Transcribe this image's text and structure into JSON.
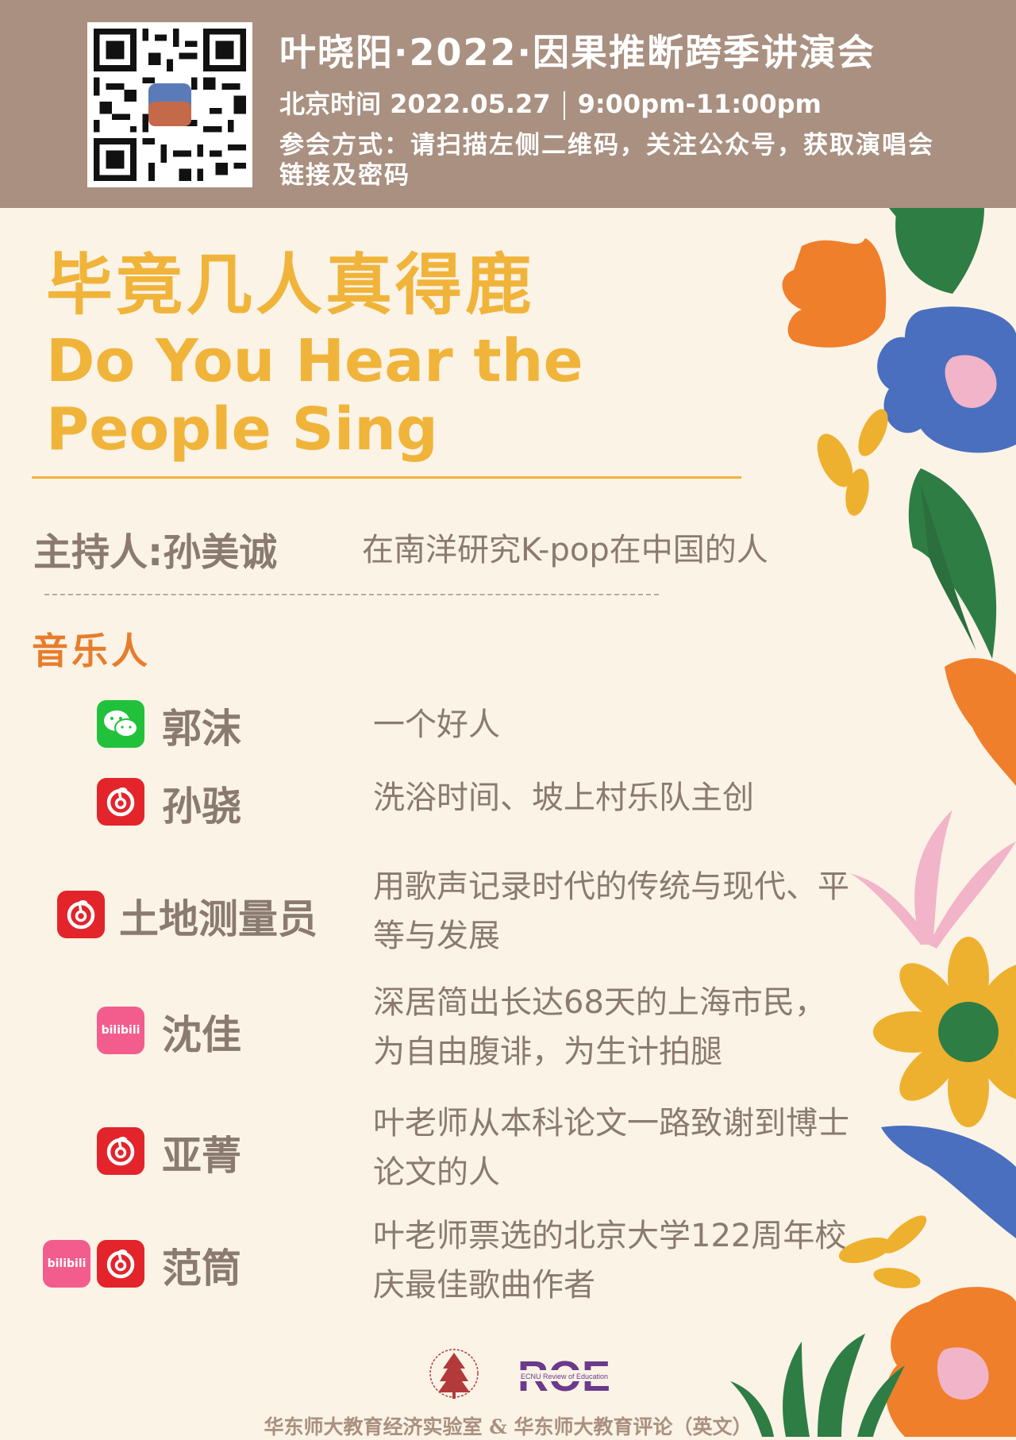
{
  "header": {
    "title": "叶晓阳·2022·因果推断跨季讲演会",
    "date": "北京时间 2022.05.27",
    "time": "9:00pm-11:00pm",
    "join_info": "参会方式：请扫描左侧二维码，关注公众号，获取演唱会链接及密码"
  },
  "event": {
    "title_zh": "毕竟几人真得鹿",
    "title_en_line1": "Do You Hear the",
    "title_en_line2": "People Sing"
  },
  "host": {
    "label": "主持人:孙美诚",
    "description": "在南洋研究K-pop在中国的人"
  },
  "musicians_heading": "音乐人",
  "musicians": [
    {
      "name": "郭沫",
      "icons": [
        "wechat-icon"
      ],
      "description": "一个好人"
    },
    {
      "name": "孙骁",
      "icons": [
        "netease-music-icon"
      ],
      "description": "洗浴时间、坡上村乐队主创"
    },
    {
      "name": "土地测量员",
      "icons": [
        "netease-music-icon"
      ],
      "description": "用歌声记录时代的传统与现代、平等与发展"
    },
    {
      "name": "沈佳",
      "icons": [
        "bilibili-icon"
      ],
      "description": "深居简出长达68天的上海市民，为自由腹诽，为生计拍腿"
    },
    {
      "name": "亚菁",
      "icons": [
        "netease-music-icon"
      ],
      "description": "叶老师从本科论文一路致谢到博士论文的人"
    },
    {
      "name": "范筒",
      "icons": [
        "bilibili-icon",
        "netease-music-icon"
      ],
      "description": "叶老师票选的北京大学122周年校庆最佳歌曲作者"
    }
  ],
  "logos": {
    "roe_text": "ROE",
    "roe_sub": "ECNU Review of Education"
  },
  "footer": "华东师大教育经济实验室 & 华东师大教育评论（英文）",
  "colors": {
    "header_bg": "#a99080",
    "page_bg": "#fbf3e6",
    "gold": "#f0b43a",
    "orange": "#e77d2c",
    "text_brown": "#8a7a70"
  }
}
